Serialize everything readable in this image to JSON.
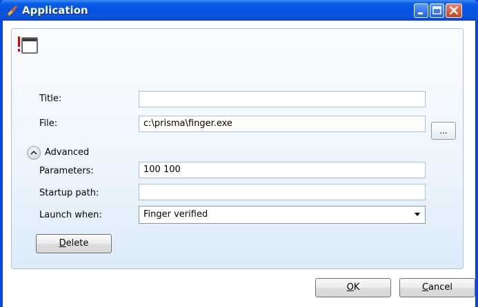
{
  "window": {
    "title": "Application"
  },
  "form": {
    "title_label": "Title:",
    "title_value": "",
    "file_label": "File:",
    "file_value": "c:\\prisma\\finger.exe",
    "browse_label": "...",
    "advanced_label": "Advanced",
    "parameters_label": "Parameters:",
    "parameters_value": "100 100",
    "startup_label": "Startup path:",
    "startup_value": "",
    "launch_label": "Launch when:",
    "launch_value": "Finger verified"
  },
  "buttons": {
    "delete_first": "D",
    "delete_rest": "elete",
    "ok_first": "O",
    "ok_rest": "K",
    "cancel_first": "C",
    "cancel_rest": "ancel"
  },
  "colors": {
    "titlebar": "#0553e0",
    "panel_border": "#a7c0db",
    "warning_red": "#e00000"
  },
  "icons": {
    "app": "paint-brush-icon",
    "warning": "exclamation-icon",
    "window": "window-icon",
    "advanced": "chevron-up-icon",
    "dropdown": "caret-down-icon"
  }
}
